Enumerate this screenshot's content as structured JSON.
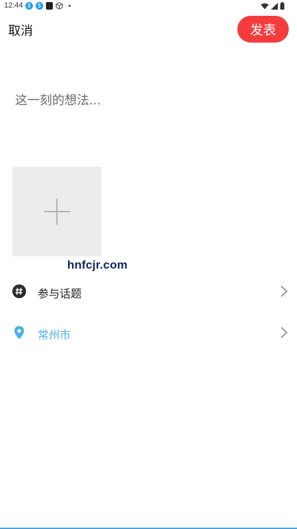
{
  "status_bar": {
    "time": "12:44",
    "notification_icons": [
      "app-notification-icon",
      "app-notification-icon",
      "app-square-icon",
      "cube-icon",
      "dot-icon"
    ],
    "system_icons": [
      "wifi-icon",
      "signal-icon",
      "battery-icon"
    ]
  },
  "header": {
    "cancel_label": "取消",
    "publish_label": "发表",
    "publish_color": "#f53c3c"
  },
  "compose": {
    "placeholder": "这一刻的想法...",
    "value": ""
  },
  "media": {
    "add_icon": "plus-icon"
  },
  "watermark": "hnfcjr.com",
  "options": {
    "topic": {
      "label": "参与话题",
      "icon": "hashtag-icon"
    },
    "location": {
      "label": "常州市",
      "icon": "location-pin-icon",
      "color": "#4ab0ea"
    }
  }
}
